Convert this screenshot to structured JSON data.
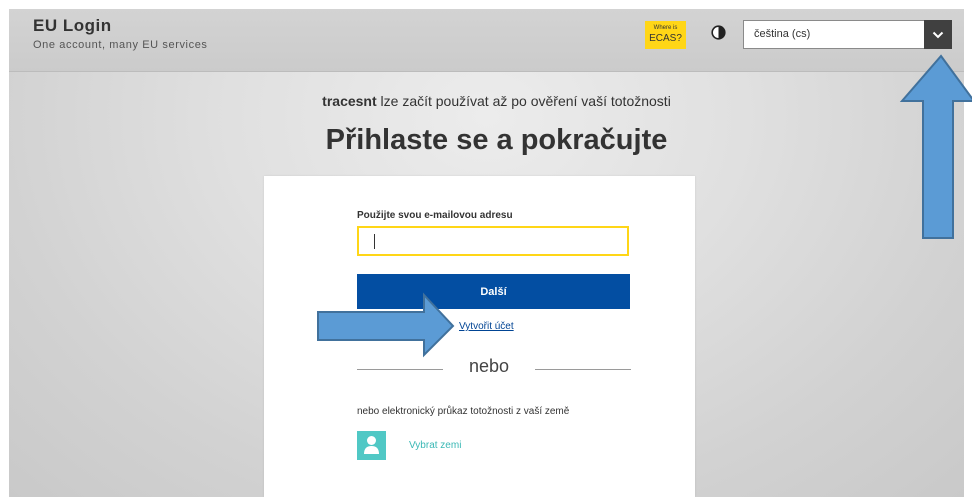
{
  "header": {
    "title": "EU Login",
    "subtitle": "One account, many EU services",
    "ecas_line1": "Where is",
    "ecas_line2": "ECAS?",
    "contrast_icon": "contrast-icon",
    "language_value": "čeština (cs)",
    "language_icon": "chevron-down-icon"
  },
  "main": {
    "lead_name": "tracesnt",
    "lead_rest": " lze začít používat až po ověření vaší totožnosti",
    "headline": "Přihlaste se a pokračujte"
  },
  "form": {
    "email_label": "Použijte svou e-mailovou adresu",
    "email_value": "",
    "next_label": "Další",
    "create_account": "Vytvořit účet",
    "or_label": "nebo",
    "eid_text": "nebo elektronický průkaz totožnosti z vaší země",
    "select_country": "Vybrat zemi",
    "country_icon": "user-icon"
  },
  "colors": {
    "accent_yellow": "#ffd617",
    "button_blue": "#034ea2",
    "annotation_arrow": "#5b9bd5",
    "country_teal": "#50c8c5"
  }
}
